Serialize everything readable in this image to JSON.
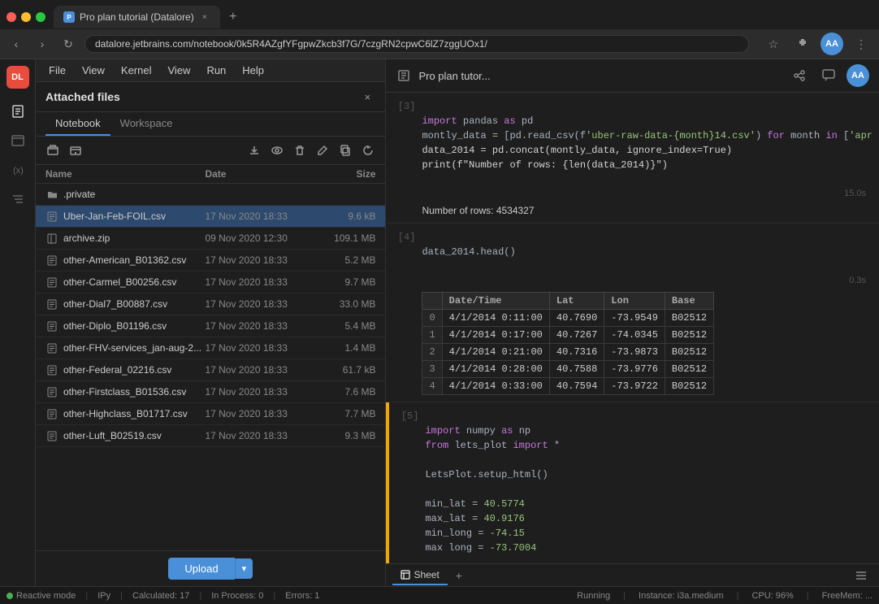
{
  "browser": {
    "tab_title": "Pro plan tutorial (Datalore)",
    "url": "datalore.jetbrains.com/notebook/0k5R4AZgfYFgpwZkcb3f7G/7czgRN2cpwC6lZ7zggUOx1/",
    "new_tab_icon": "+",
    "nav_back": "‹",
    "nav_forward": "›",
    "nav_refresh": "↻",
    "bookmark_icon": "☆",
    "avatar_initials": "AA"
  },
  "app": {
    "logo": "DL",
    "menu_items": [
      "File",
      "View",
      "Kernel",
      "View",
      "Run",
      "Help"
    ]
  },
  "panel": {
    "title": "Attached files",
    "tabs": [
      "Notebook",
      "Workspace"
    ],
    "active_tab": "Notebook",
    "toolbar_buttons": [
      "folder-icon",
      "folder-add-icon",
      "download-icon",
      "eye-icon",
      "trash-icon",
      "edit-icon",
      "copy-icon",
      "refresh-icon"
    ],
    "columns": [
      "Name",
      "Date",
      "Size"
    ],
    "files": [
      {
        "name": ".private",
        "date": "",
        "size": "",
        "type": "folder"
      },
      {
        "name": "Uber-Jan-Feb-FOIL.csv",
        "date": "17 Nov 2020 18:33",
        "size": "9.6 kB",
        "type": "csv",
        "selected": true
      },
      {
        "name": "archive.zip",
        "date": "09 Nov 2020 12:30",
        "size": "109.1 MB",
        "type": "zip"
      },
      {
        "name": "other-American_B01362.csv",
        "date": "17 Nov 2020 18:33",
        "size": "5.2 MB",
        "type": "csv"
      },
      {
        "name": "other-Carmel_B00256.csv",
        "date": "17 Nov 2020 18:33",
        "size": "9.7 MB",
        "type": "csv"
      },
      {
        "name": "other-Dial7_B00887.csv",
        "date": "17 Nov 2020 18:33",
        "size": "33.0 MB",
        "type": "csv"
      },
      {
        "name": "other-Diplo_B01196.csv",
        "date": "17 Nov 2020 18:33",
        "size": "5.4 MB",
        "type": "csv"
      },
      {
        "name": "other-FHV-services_jan-aug-2...",
        "date": "17 Nov 2020 18:33",
        "size": "1.4 MB",
        "type": "csv"
      },
      {
        "name": "other-Federal_02216.csv",
        "date": "17 Nov 2020 18:33",
        "size": "61.7 kB",
        "type": "csv"
      },
      {
        "name": "other-Firstclass_B01536.csv",
        "date": "17 Nov 2020 18:33",
        "size": "7.6 MB",
        "type": "csv"
      },
      {
        "name": "other-Highclass_B01717.csv",
        "date": "17 Nov 2020 18:33",
        "size": "7.7 MB",
        "type": "csv"
      },
      {
        "name": "other-Luft_B02519.csv",
        "date": "17 Nov 2020 18:33",
        "size": "9.3 MB",
        "type": "csv"
      }
    ],
    "upload_button": "Upload"
  },
  "notebook": {
    "title": "Pro plan tutor...",
    "cells": [
      {
        "number": "[3]",
        "timing": "15.0s",
        "code_lines": [
          "import pandas as pd",
          "montly_data = [pd.read_csv(f'uber-raw-data-{month}14.csv') for month in ['apr",
          "data_2014 = pd.concat(montly_data, ignore_index=True)",
          "print(f\"Number of rows: {len(data_2014)}\")"
        ],
        "output": "Number of rows: 4534327"
      },
      {
        "number": "[4]",
        "timing": "0.3s",
        "code": "data_2014.head()",
        "has_table": true,
        "table": {
          "headers": [
            "",
            "Date/Time",
            "Lat",
            "Lon",
            "Base"
          ],
          "rows": [
            [
              "0",
              "4/1/2014 0:11:00",
              "40.7690",
              "-73.9549",
              "B02512"
            ],
            [
              "1",
              "4/1/2014 0:17:00",
              "40.7267",
              "-74.0345",
              "B02512"
            ],
            [
              "2",
              "4/1/2014 0:21:00",
              "40.7316",
              "-73.9873",
              "B02512"
            ],
            [
              "3",
              "4/1/2014 0:28:00",
              "40.7588",
              "-73.9776",
              "B02512"
            ],
            [
              "4",
              "4/1/2014 0:33:00",
              "40.7594",
              "-73.9722",
              "B02512"
            ]
          ]
        }
      },
      {
        "number": "[5]",
        "has_indicator": true,
        "code_lines": [
          "import numpy as np",
          "from lets_plot import *",
          "",
          "LetsPlot.setup_html()",
          "",
          "min_lat = 40.5774",
          "max_lat = 40.9176",
          "min_long = -74.15",
          "max long = -73.7004"
        ]
      }
    ],
    "bottom_tab": "Sheet",
    "add_tab": "+"
  },
  "status": {
    "reactive_mode": "Reactive mode",
    "kernel": "IPy",
    "calculated": "Calculated: 17",
    "in_process": "In Process: 0",
    "errors": "Errors: 1",
    "running": "Running",
    "instance": "Instance: i3a.medium",
    "cpu": "CPU: 96%",
    "free_mem": "FreeMem: ..."
  }
}
